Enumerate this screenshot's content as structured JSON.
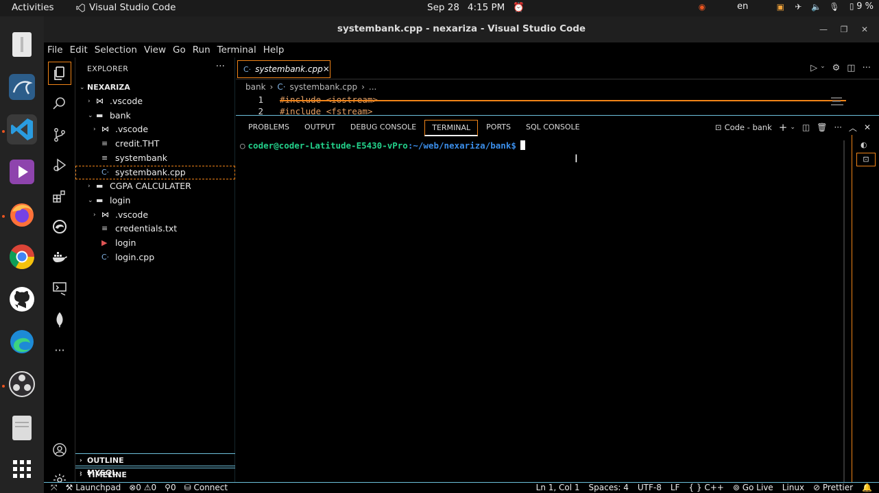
{
  "topbar": {
    "activities": "Activities",
    "app_name": "Visual Studio Code",
    "date": "Sep 28",
    "time": "4:15 PM",
    "language": "en",
    "battery": "9 %"
  },
  "window": {
    "title": "systembank.cpp - nexariza - Visual Studio Code"
  },
  "menu": [
    "File",
    "Edit",
    "Selection",
    "View",
    "Go",
    "Run",
    "Terminal",
    "Help"
  ],
  "sidebar": {
    "header": "EXPLORER",
    "more": "···",
    "root": "NEXARIZA",
    "tree": [
      {
        "label": ".vscode",
        "icon": "vscode-folder-icon",
        "indent": 1,
        "chev": "›"
      },
      {
        "label": "bank",
        "icon": "folder-icon",
        "indent": 1,
        "chev": "⌄"
      },
      {
        "label": ".vscode",
        "icon": "vscode-folder-icon",
        "indent": 2,
        "chev": "›"
      },
      {
        "label": "credit.THT",
        "icon": "file-icon",
        "indent": 2,
        "chev": ""
      },
      {
        "label": "systembank",
        "icon": "file-icon",
        "indent": 2,
        "chev": ""
      },
      {
        "label": "systembank.cpp",
        "icon": "cpp-file-icon",
        "indent": 2,
        "chev": "",
        "selected": true
      },
      {
        "label": "CGPA CALCULATER",
        "icon": "folder-icon",
        "indent": 1,
        "chev": "›"
      },
      {
        "label": "login",
        "icon": "folder-icon",
        "indent": 1,
        "chev": "⌄"
      },
      {
        "label": ".vscode",
        "icon": "vscode-folder-icon",
        "indent": 2,
        "chev": "›"
      },
      {
        "label": "credentials.txt",
        "icon": "file-icon",
        "indent": 2,
        "chev": ""
      },
      {
        "label": "login",
        "icon": "executable-icon",
        "indent": 2,
        "chev": ""
      },
      {
        "label": "login.cpp",
        "icon": "cpp-file-icon",
        "indent": 2,
        "chev": ""
      }
    ],
    "sections": [
      "OUTLINE",
      "TIMELINE",
      "MYSQL"
    ]
  },
  "editor": {
    "tab": "systembank.cpp",
    "breadcrumb": [
      "bank",
      "systembank.cpp",
      "..."
    ],
    "lines": [
      {
        "num": "1",
        "text": "#include <iostream>"
      },
      {
        "num": "2",
        "text": "#include <fstream>"
      }
    ]
  },
  "panel": {
    "tabs": [
      "PROBLEMS",
      "OUTPUT",
      "DEBUG CONSOLE",
      "TERMINAL",
      "PORTS",
      "SQL CONSOLE"
    ],
    "active_tab": "TERMINAL",
    "terminal_name": "Code - bank",
    "prompt_user": "coder@coder-Latitude-E5430-vPro",
    "prompt_path": ":~/web/nexariza/bank$"
  },
  "status": {
    "left": [
      "Launchpad",
      "0",
      "0",
      "0",
      "Connect"
    ],
    "position": "Ln 1, Col 1",
    "spaces": "Spaces: 4",
    "encoding": "UTF-8",
    "eol": "LF",
    "braces": "{ }",
    "language": "C++",
    "golive": "Go Live",
    "os": "Linux",
    "prettier": "Prettier"
  },
  "colors": {
    "accent_orange": "#f38518",
    "contrast_border": "#6fc3df",
    "terminal_green": "#23d18b",
    "terminal_blue": "#3b8eea"
  }
}
